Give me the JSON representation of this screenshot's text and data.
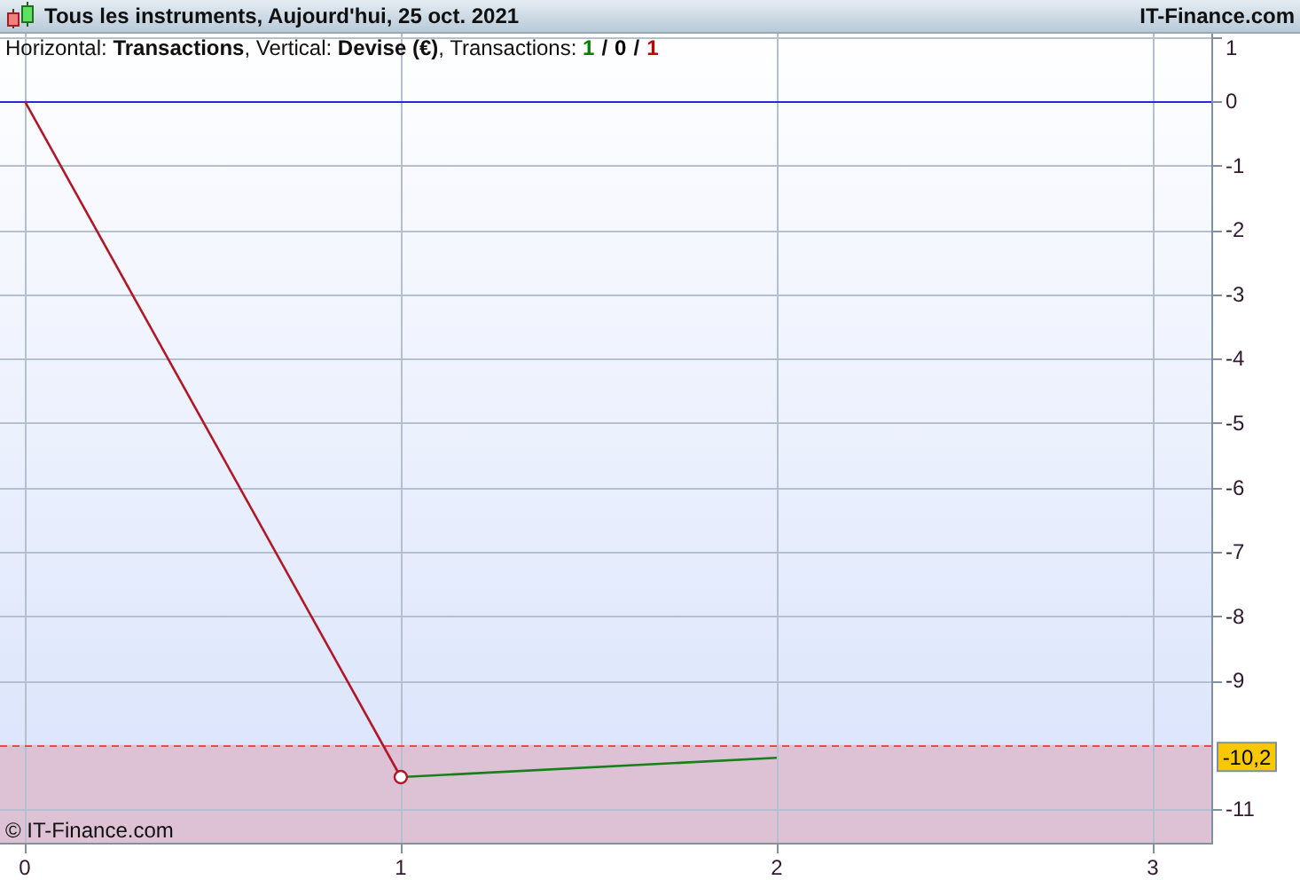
{
  "window": {
    "title": "Tous les instruments, Aujourd'hui, 25 oct. 2021",
    "brand": "IT-Finance.com"
  },
  "info": {
    "text": "Horizontal: **Transactions**, Vertical: **Devise (€)**, Transactions: ",
    "separator": "/",
    "counts": [
      {
        "value": "1",
        "color": "#008000"
      },
      {
        "value": "0",
        "color": "#000000"
      },
      {
        "value": "1",
        "color": "#c00000"
      }
    ]
  },
  "copyright": "© IT-Finance.com",
  "chart_data": {
    "type": "line",
    "x": [
      0,
      1,
      2
    ],
    "xlim": [
      -0.066,
      3.156
    ],
    "ylim": [
      -11.52,
      1.05
    ],
    "xticks": [
      0,
      1,
      2,
      3
    ],
    "yticks": [
      1,
      0,
      -1,
      -2,
      -3,
      -4,
      -5,
      -6,
      -7,
      -8,
      -9,
      -11
    ],
    "grid": true,
    "series": [
      {
        "color": "#b01828",
        "values": [
          0,
          -10.5,
          null
        ]
      },
      {
        "color": "#188018",
        "values": [
          null,
          -10.5,
          -10.2
        ]
      }
    ],
    "ref_lines": [
      {
        "axis": "y",
        "value": 0,
        "color": "#2828e0"
      },
      {
        "axis": "y",
        "value": -10,
        "color": "#e05050"
      }
    ],
    "annotations": [
      {
        "y": -10.2,
        "text": "-10,2"
      }
    ]
  }
}
